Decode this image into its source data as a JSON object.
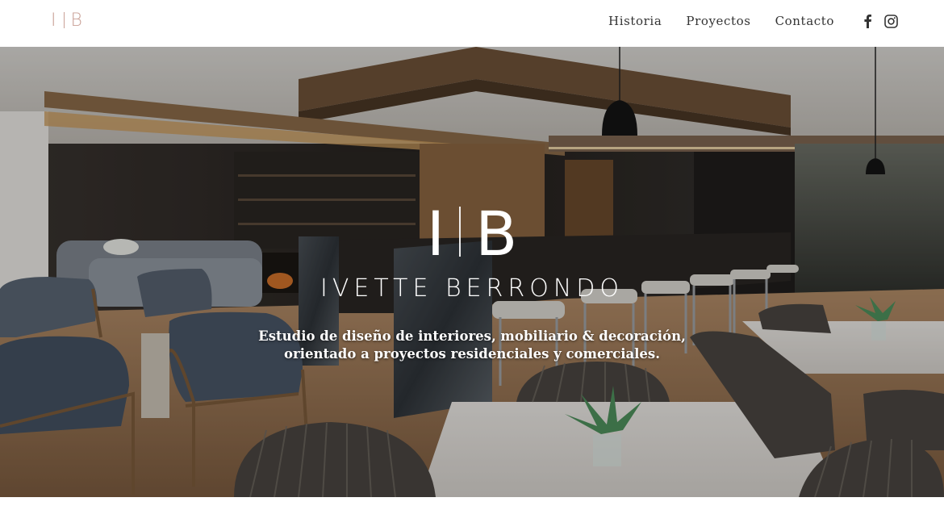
{
  "brand": {
    "logo_left": "I",
    "logo_right": "B",
    "accent_color": "#c9a096"
  },
  "nav": {
    "items": [
      {
        "label": "Historia"
      },
      {
        "label": "Proyectos"
      },
      {
        "label": "Contacto"
      }
    ],
    "social": [
      {
        "icon": "facebook-icon"
      },
      {
        "icon": "instagram-icon"
      }
    ]
  },
  "hero": {
    "logo_left": "I",
    "logo_right": "B",
    "name": "IVETTE BERRONDO",
    "tagline_line1": "Estudio de diseño de interiores, mobiliario & decoración,",
    "tagline_line2": "orientado a proyectos residenciales y comerciales."
  }
}
